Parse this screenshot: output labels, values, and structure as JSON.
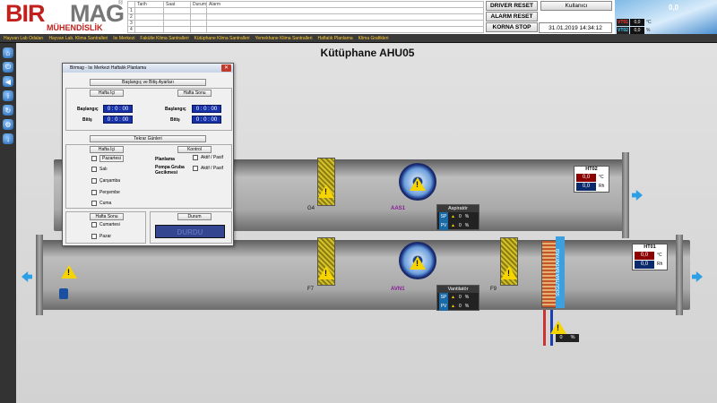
{
  "brand": {
    "name_part1": "BIR",
    "name_part2": "MAG",
    "tagline": "MÜHENDİSLİK",
    "reg": "®"
  },
  "alarm_table": {
    "headers": [
      "",
      "Tarih",
      "Saat",
      "Durum",
      "Alarm"
    ],
    "rows": [
      "1",
      "2",
      "3",
      "4"
    ]
  },
  "header_buttons": {
    "driver_reset": "DRIVER RESET",
    "alarm_reset": "ALARM RESET",
    "horn_stop": "KORNA STOP",
    "user": "Kullanıcı"
  },
  "datetime": "31.01.2019 14:34:12",
  "weather": {
    "rows": [
      {
        "label": "VT01",
        "value": "0,0",
        "unit": "°C"
      },
      {
        "label": "VT02",
        "value": "0,0",
        "unit": "%"
      }
    ],
    "temp": "0,0"
  },
  "menu": [
    "Hayvan Lab Odaları",
    "Hayvan Lab. Klima Santralleri",
    "Isı Merkezi",
    "Fakülte Klima Santralleri",
    "Kütüphane Klima Santralleri",
    "Yemekhane Klima Santralleri",
    "Haftalık Planlama",
    "Klima Grafikleri"
  ],
  "sidebar_icons": [
    "home-icon",
    "power-icon",
    "back-icon",
    "info-icon",
    "refresh-icon",
    "network-icon",
    "download-icon"
  ],
  "page_title": "Kütüphane AHU05",
  "upper": {
    "filter": "G4",
    "fan": "AAS1",
    "controller": {
      "title": "Aspiratör",
      "sp": "SP",
      "pv": "PV",
      "sp_val": "0",
      "pv_val": "0",
      "unit": "%"
    },
    "sensor": {
      "title": "HT02",
      "temp": "0,0",
      "temp_unit": "°C",
      "hum": "0,0",
      "hum_unit": "Rh"
    }
  },
  "lower": {
    "filter1": "F7",
    "fan": "AVN1",
    "filter2": "F9",
    "coil": "SOĞUTMA BATARYASI",
    "controller": {
      "title": "Vantilatör",
      "sp": "SP",
      "pv": "PV",
      "sp_val": "0",
      "pv_val": "0",
      "unit": "%"
    },
    "sensor": {
      "title": "HT01",
      "temp": "0,0",
      "temp_unit": "°C",
      "hum": "0,0",
      "hum_unit": "Rh"
    },
    "valve": {
      "value": "0",
      "unit": "%"
    }
  },
  "dialog": {
    "title": "Birmag - Isı Merkezi Haftalık Planlama",
    "close": "✕",
    "section_start_end": "Başlangıç ve Bitiş Ayarları",
    "weekday": "Hafta İçi",
    "weekend": "Hafta Sonu",
    "start": "Başlangıç",
    "end": "Bitiş",
    "times": {
      "wd_start": "0 : 0 : 00",
      "wd_end": "0 : 0 : 00",
      "we_start": "0 : 0 : 00",
      "we_end": "0 : 0 : 00"
    },
    "repeat_days": "Tekrar Günleri",
    "weekday2": "Hafta İçi",
    "days": [
      "Pazartesi",
      "Salı",
      "Çarşamba",
      "Perşembe",
      "Cuma"
    ],
    "control": "Kontrol",
    "planning": "Planlama",
    "pump_delay": "Pompa Gruba Gecikmesi",
    "active_passive": "Aktif / Pasif",
    "weekend2": "Hafta Sonu",
    "weekend_days": [
      "Cumartesi",
      "Pazar"
    ],
    "status": "Durum",
    "status_value": "DURDU"
  }
}
